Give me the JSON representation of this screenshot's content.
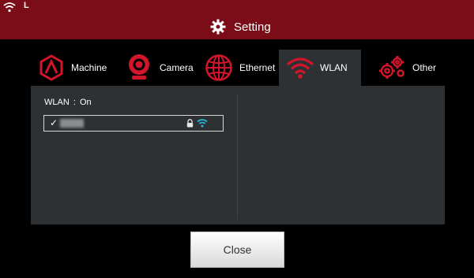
{
  "status_bar": {
    "wifi_icon": "wifi-icon",
    "usb_icon": "usb-icon",
    "usb_label": "L"
  },
  "title": {
    "icon": "gear-icon",
    "text": "Setting"
  },
  "tabs": [
    {
      "label": "Machine",
      "icon": "machine-icon",
      "active": false
    },
    {
      "label": "Camera",
      "icon": "camera-icon",
      "active": false
    },
    {
      "label": "Ethernet",
      "icon": "globe-icon",
      "active": false
    },
    {
      "label": "WLAN",
      "icon": "wifi-icon",
      "active": true
    },
    {
      "label": "Other",
      "icon": "gears-icon",
      "active": false
    }
  ],
  "wlan": {
    "label": "WLAN",
    "separator": ":",
    "state": "On",
    "networks": [
      {
        "connected": true,
        "check": "✓",
        "secured": true,
        "signal": "full"
      }
    ]
  },
  "close_label": "Close",
  "colors": {
    "accent": "#7a0d18",
    "icon_red": "#d3152c",
    "panel": "#2e3133",
    "wifi_blue": "#29b6d6"
  }
}
